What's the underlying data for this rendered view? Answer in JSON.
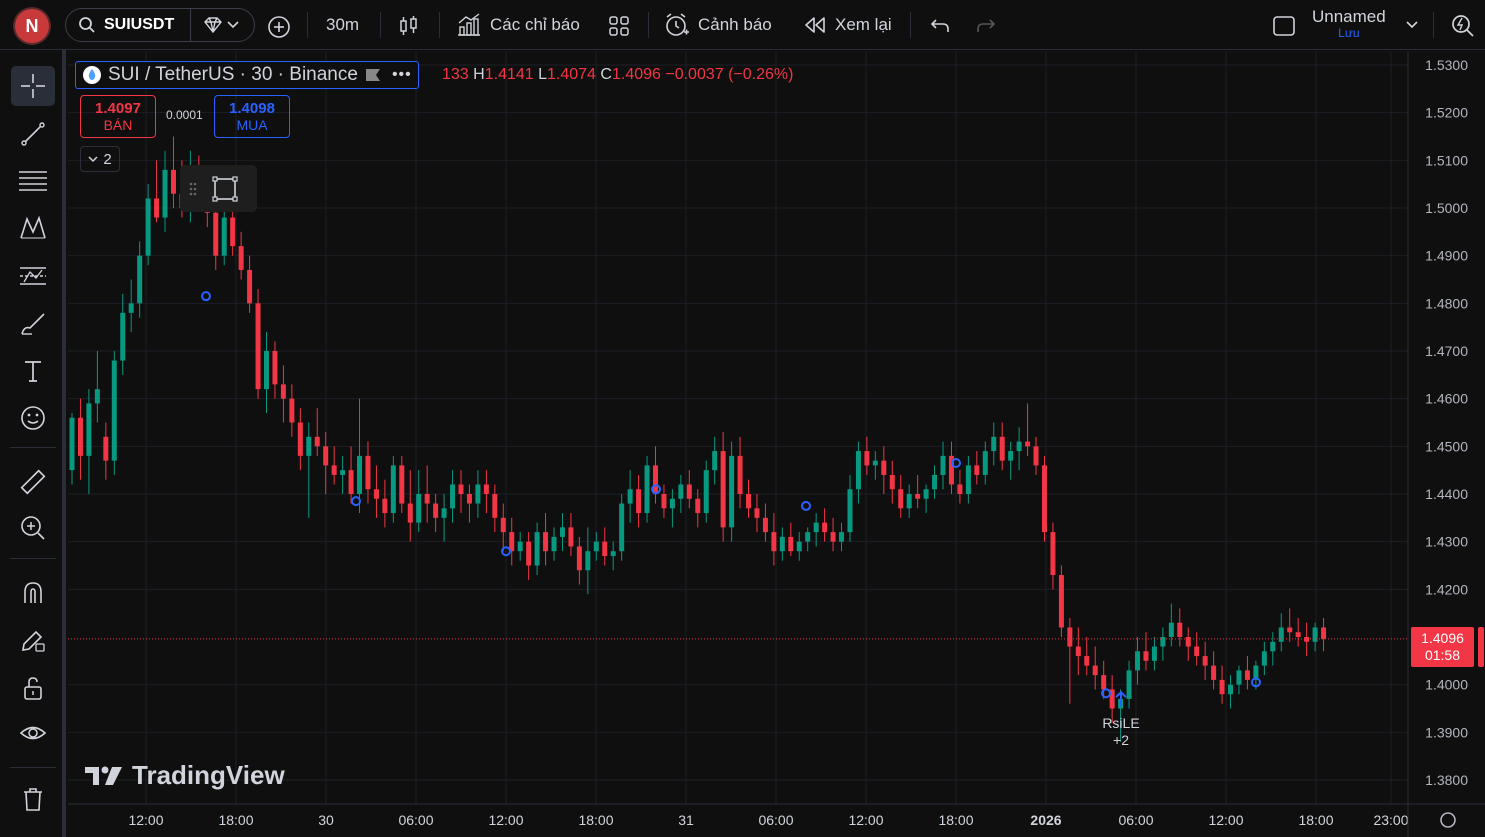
{
  "topbar": {
    "avatar_letter": "N",
    "symbol": "SUIUSDT",
    "interval": "30m",
    "indicators_label": "Các chỉ báo",
    "alerts_label": "Cảnh báo",
    "replay_label": "Xem lại",
    "layout_name": "Unnamed",
    "save_label": "Lưu"
  },
  "legend": {
    "title": "SUI / TetherUS · 30 · Binance",
    "open_partial": "133",
    "h_key": "H",
    "high": "1.4141",
    "l_key": "L",
    "low": "1.4074",
    "c_key": "C",
    "close": "1.4096",
    "change": "−0.0037 (−0.26%)",
    "sell_price": "1.4097",
    "sell_label": "BÁN",
    "spread": "0.0001",
    "buy_price": "1.4098",
    "buy_label": "MUA",
    "indicators_count": "2"
  },
  "price_axis": {
    "ticks": [
      "1.5300",
      "1.5200",
      "1.5100",
      "1.5000",
      "1.4900",
      "1.4800",
      "1.4700",
      "1.4600",
      "1.4500",
      "1.4400",
      "1.4300",
      "1.4200",
      "1.4000",
      "1.3900",
      "1.3800"
    ],
    "last_price": "1.4096",
    "countdown": "01:58"
  },
  "time_axis": {
    "ticks": [
      "12:00",
      "18:00",
      "30",
      "06:00",
      "12:00",
      "18:00",
      "31",
      "06:00",
      "12:00",
      "18:00",
      "2026",
      "06:00",
      "12:00",
      "18:00",
      "23:00"
    ]
  },
  "strategy_label": {
    "name": "RsiLE",
    "more": "+2"
  },
  "branding": {
    "logo_text": "TradingView"
  },
  "colors": {
    "up": "#089981",
    "down": "#f23645",
    "accent": "#2962ff",
    "background": "#0f0f0f"
  },
  "chart_data": {
    "type": "candlestick",
    "symbol": "SUI / TetherUS",
    "interval": "30",
    "exchange": "Binance",
    "ylim": [
      1.375,
      1.535
    ],
    "last_price": 1.4096,
    "candles_ohlc": [
      [
        1.445,
        1.457,
        1.442,
        1.456
      ],
      [
        1.456,
        1.46,
        1.443,
        1.448
      ],
      [
        1.448,
        1.462,
        1.44,
        1.459
      ],
      [
        1.459,
        1.47,
        1.455,
        1.462
      ],
      [
        1.452,
        1.455,
        1.443,
        1.447
      ],
      [
        1.447,
        1.47,
        1.444,
        1.468
      ],
      [
        1.468,
        1.482,
        1.465,
        1.478
      ],
      [
        1.478,
        1.485,
        1.474,
        1.48
      ],
      [
        1.48,
        1.493,
        1.477,
        1.49
      ],
      [
        1.49,
        1.505,
        1.488,
        1.502
      ],
      [
        1.502,
        1.51,
        1.497,
        1.498
      ],
      [
        1.498,
        1.512,
        1.495,
        1.508
      ],
      [
        1.508,
        1.515,
        1.5,
        1.503
      ],
      [
        1.503,
        1.51,
        1.498,
        1.5
      ],
      [
        1.5,
        1.512,
        1.497,
        1.508
      ],
      [
        1.508,
        1.511,
        1.502,
        1.504
      ],
      [
        1.504,
        1.507,
        1.496,
        1.499
      ],
      [
        1.499,
        1.502,
        1.487,
        1.49
      ],
      [
        1.49,
        1.5,
        1.488,
        1.498
      ],
      [
        1.498,
        1.5,
        1.49,
        1.492
      ],
      [
        1.492,
        1.495,
        1.485,
        1.487
      ],
      [
        1.487,
        1.49,
        1.478,
        1.48
      ],
      [
        1.48,
        1.483,
        1.46,
        1.462
      ],
      [
        1.462,
        1.474,
        1.457,
        1.47
      ],
      [
        1.47,
        1.472,
        1.46,
        1.463
      ],
      [
        1.463,
        1.467,
        1.455,
        1.46
      ],
      [
        1.46,
        1.463,
        1.452,
        1.455
      ],
      [
        1.455,
        1.458,
        1.445,
        1.448
      ],
      [
        1.448,
        1.455,
        1.435,
        1.452
      ],
      [
        1.452,
        1.458,
        1.448,
        1.45
      ],
      [
        1.45,
        1.453,
        1.44,
        1.446
      ],
      [
        1.446,
        1.45,
        1.442,
        1.444
      ],
      [
        1.444,
        1.448,
        1.44,
        1.445
      ],
      [
        1.445,
        1.45,
        1.438,
        1.44
      ],
      [
        1.44,
        1.46,
        1.436,
        1.448
      ],
      [
        1.448,
        1.451,
        1.438,
        1.441
      ],
      [
        1.441,
        1.446,
        1.435,
        1.439
      ],
      [
        1.439,
        1.443,
        1.433,
        1.436
      ],
      [
        1.436,
        1.448,
        1.434,
        1.446
      ],
      [
        1.446,
        1.448,
        1.436,
        1.438
      ],
      [
        1.438,
        1.445,
        1.43,
        1.434
      ],
      [
        1.434,
        1.445,
        1.432,
        1.44
      ],
      [
        1.44,
        1.446,
        1.434,
        1.438
      ],
      [
        1.438,
        1.44,
        1.432,
        1.435
      ],
      [
        1.435,
        1.44,
        1.43,
        1.437
      ],
      [
        1.437,
        1.445,
        1.434,
        1.442
      ],
      [
        1.442,
        1.445,
        1.436,
        1.44
      ],
      [
        1.44,
        1.442,
        1.434,
        1.438
      ],
      [
        1.438,
        1.445,
        1.435,
        1.442
      ],
      [
        1.442,
        1.445,
        1.436,
        1.44
      ],
      [
        1.44,
        1.442,
        1.432,
        1.435
      ],
      [
        1.435,
        1.438,
        1.428,
        1.432
      ],
      [
        1.432,
        1.435,
        1.425,
        1.428
      ],
      [
        1.428,
        1.432,
        1.426,
        1.43
      ],
      [
        1.43,
        1.432,
        1.422,
        1.425
      ],
      [
        1.425,
        1.434,
        1.423,
        1.432
      ],
      [
        1.432,
        1.436,
        1.425,
        1.428
      ],
      [
        1.428,
        1.433,
        1.426,
        1.431
      ],
      [
        1.431,
        1.436,
        1.428,
        1.433
      ],
      [
        1.433,
        1.436,
        1.427,
        1.429
      ],
      [
        1.429,
        1.431,
        1.421,
        1.424
      ],
      [
        1.424,
        1.433,
        1.419,
        1.428
      ],
      [
        1.428,
        1.432,
        1.426,
        1.43
      ],
      [
        1.43,
        1.433,
        1.425,
        1.427
      ],
      [
        1.427,
        1.43,
        1.424,
        1.428
      ],
      [
        1.428,
        1.44,
        1.426,
        1.438
      ],
      [
        1.438,
        1.445,
        1.434,
        1.441
      ],
      [
        1.441,
        1.444,
        1.433,
        1.436
      ],
      [
        1.436,
        1.448,
        1.434,
        1.446
      ],
      [
        1.446,
        1.45,
        1.438,
        1.44
      ],
      [
        1.44,
        1.442,
        1.435,
        1.437
      ],
      [
        1.437,
        1.441,
        1.433,
        1.439
      ],
      [
        1.439,
        1.444,
        1.436,
        1.442
      ],
      [
        1.442,
        1.445,
        1.437,
        1.439
      ],
      [
        1.439,
        1.441,
        1.433,
        1.436
      ],
      [
        1.436,
        1.447,
        1.434,
        1.445
      ],
      [
        1.445,
        1.452,
        1.442,
        1.449
      ],
      [
        1.449,
        1.453,
        1.43,
        1.433
      ],
      [
        1.433,
        1.451,
        1.43,
        1.448
      ],
      [
        1.448,
        1.452,
        1.437,
        1.44
      ],
      [
        1.44,
        1.443,
        1.435,
        1.437
      ],
      [
        1.437,
        1.44,
        1.432,
        1.435
      ],
      [
        1.435,
        1.438,
        1.43,
        1.432
      ],
      [
        1.432,
        1.436,
        1.425,
        1.428
      ],
      [
        1.428,
        1.433,
        1.426,
        1.431
      ],
      [
        1.431,
        1.434,
        1.427,
        1.428
      ],
      [
        1.428,
        1.432,
        1.426,
        1.43
      ],
      [
        1.43,
        1.433,
        1.428,
        1.432
      ],
      [
        1.432,
        1.436,
        1.429,
        1.434
      ],
      [
        1.434,
        1.437,
        1.43,
        1.432
      ],
      [
        1.432,
        1.435,
        1.428,
        1.43
      ],
      [
        1.43,
        1.434,
        1.428,
        1.432
      ],
      [
        1.432,
        1.444,
        1.43,
        1.441
      ],
      [
        1.441,
        1.451,
        1.438,
        1.449
      ],
      [
        1.449,
        1.452,
        1.444,
        1.446
      ],
      [
        1.446,
        1.449,
        1.443,
        1.447
      ],
      [
        1.447,
        1.45,
        1.44,
        1.444
      ],
      [
        1.444,
        1.447,
        1.438,
        1.441
      ],
      [
        1.441,
        1.444,
        1.435,
        1.437
      ],
      [
        1.437,
        1.442,
        1.435,
        1.44
      ],
      [
        1.44,
        1.444,
        1.437,
        1.439
      ],
      [
        1.439,
        1.442,
        1.436,
        1.441
      ],
      [
        1.441,
        1.446,
        1.439,
        1.444
      ],
      [
        1.444,
        1.451,
        1.441,
        1.448
      ],
      [
        1.448,
        1.451,
        1.44,
        1.442
      ],
      [
        1.442,
        1.445,
        1.438,
        1.44
      ],
      [
        1.44,
        1.448,
        1.438,
        1.446
      ],
      [
        1.446,
        1.449,
        1.442,
        1.444
      ],
      [
        1.444,
        1.451,
        1.442,
        1.449
      ],
      [
        1.449,
        1.455,
        1.446,
        1.452
      ],
      [
        1.452,
        1.455,
        1.445,
        1.447
      ],
      [
        1.447,
        1.451,
        1.443,
        1.449
      ],
      [
        1.449,
        1.454,
        1.445,
        1.451
      ],
      [
        1.451,
        1.459,
        1.448,
        1.45
      ],
      [
        1.45,
        1.452,
        1.444,
        1.446
      ],
      [
        1.446,
        1.448,
        1.43,
        1.432
      ],
      [
        1.432,
        1.434,
        1.42,
        1.423
      ],
      [
        1.423,
        1.425,
        1.41,
        1.412
      ],
      [
        1.412,
        1.414,
        1.396,
        1.408
      ],
      [
        1.408,
        1.412,
        1.402,
        1.406
      ],
      [
        1.406,
        1.41,
        1.402,
        1.404
      ],
      [
        1.404,
        1.408,
        1.399,
        1.402
      ],
      [
        1.402,
        1.405,
        1.397,
        1.399
      ],
      [
        1.399,
        1.402,
        1.392,
        1.395
      ],
      [
        1.395,
        1.399,
        1.388,
        1.397
      ],
      [
        1.397,
        1.405,
        1.395,
        1.403
      ],
      [
        1.403,
        1.41,
        1.4,
        1.407
      ],
      [
        1.407,
        1.411,
        1.403,
        1.405
      ],
      [
        1.405,
        1.41,
        1.403,
        1.408
      ],
      [
        1.408,
        1.412,
        1.405,
        1.41
      ],
      [
        1.41,
        1.417,
        1.408,
        1.413
      ],
      [
        1.413,
        1.416,
        1.408,
        1.41
      ],
      [
        1.41,
        1.412,
        1.405,
        1.408
      ],
      [
        1.408,
        1.411,
        1.404,
        1.406
      ],
      [
        1.406,
        1.409,
        1.401,
        1.404
      ],
      [
        1.404,
        1.407,
        1.399,
        1.401
      ],
      [
        1.401,
        1.404,
        1.396,
        1.398
      ],
      [
        1.398,
        1.402,
        1.395,
        1.4
      ],
      [
        1.4,
        1.404,
        1.398,
        1.403
      ],
      [
        1.403,
        1.406,
        1.399,
        1.401
      ],
      [
        1.401,
        1.405,
        1.399,
        1.404
      ],
      [
        1.404,
        1.409,
        1.402,
        1.407
      ],
      [
        1.407,
        1.411,
        1.404,
        1.409
      ],
      [
        1.409,
        1.415,
        1.407,
        1.412
      ],
      [
        1.412,
        1.416,
        1.409,
        1.411
      ],
      [
        1.411,
        1.414,
        1.408,
        1.41
      ],
      [
        1.41,
        1.413,
        1.406,
        1.409
      ],
      [
        1.409,
        1.413,
        1.407,
        1.412
      ],
      [
        1.412,
        1.414,
        1.407,
        1.4096
      ]
    ]
  }
}
